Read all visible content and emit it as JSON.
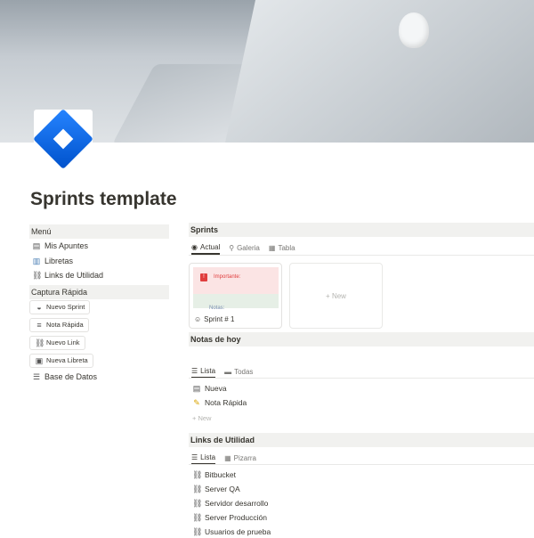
{
  "page": {
    "title": "Sprints template"
  },
  "sidebar": {
    "menu_title": "Menú",
    "menu_items": [
      {
        "label": "Mis Apuntes",
        "icon": "notepad-icon"
      },
      {
        "label": "Libretas",
        "icon": "book-icon"
      },
      {
        "label": "Links de Utilidad",
        "icon": "link-icon"
      }
    ],
    "quick_title": "Captura Rápida",
    "quick_buttons": [
      {
        "label": "Nuevo Sprint",
        "icon": "stack-icon"
      },
      {
        "label": "Nota Rápida",
        "icon": "quick-note-icon"
      },
      {
        "label": "Nuevo Link",
        "icon": "link-icon"
      },
      {
        "label": "Nueva Libreta",
        "icon": "notebook-icon"
      }
    ],
    "database_label": "Base de Datos"
  },
  "sprints": {
    "title": "Sprints",
    "tabs": [
      "Actual",
      "Galeria",
      "Tabla"
    ],
    "card": {
      "name": "Sprint # 1",
      "important_label": "Importante:",
      "notes_label": "Notas:"
    },
    "new_label": "+ New"
  },
  "notas": {
    "title": "Notas de hoy",
    "tabs": [
      "Lista",
      "Todas"
    ],
    "items": [
      "Nueva",
      "Nota Rápida"
    ],
    "new_label": "+ New"
  },
  "links": {
    "title": "Links de Utilidad",
    "tabs": [
      "Lista",
      "Pizarra"
    ],
    "items": [
      "Bitbucket",
      "Server QA",
      "Servidor desarrollo",
      "Server Producción",
      "Usuarios de prueba"
    ]
  }
}
